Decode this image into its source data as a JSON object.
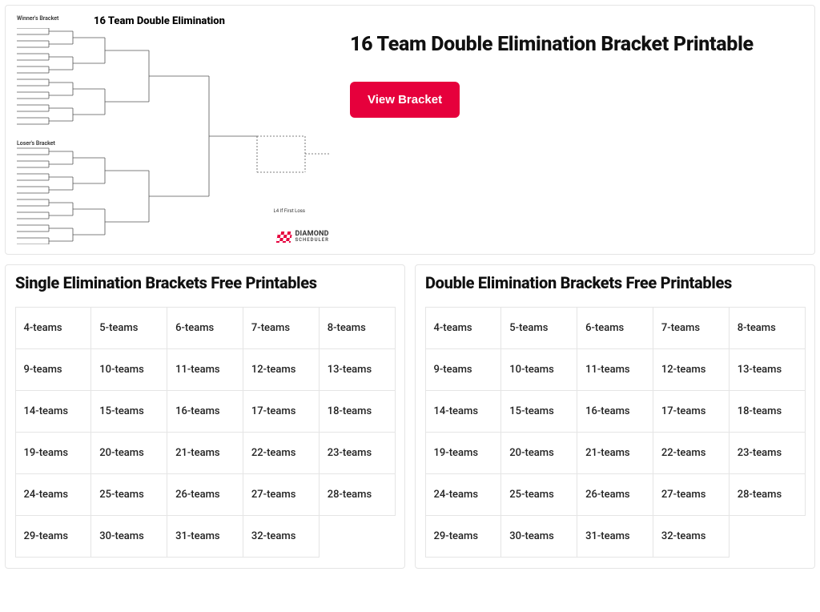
{
  "top": {
    "winners_label": "Winner's Bracket",
    "losers_label": "Loser's Bracket",
    "thumb_title": "16 Team Double Elimination",
    "note": "L4 If First Loss",
    "logo_line1": "DIAMOND",
    "logo_line2": "SCHEDULER",
    "heading": "16 Team Double Elimination Bracket Printable",
    "button": "View Bracket"
  },
  "single": {
    "heading": "Single Elimination Brackets Free Printables",
    "items": [
      "4-teams",
      "5-teams",
      "6-teams",
      "7-teams",
      "8-teams",
      "9-teams",
      "10-teams",
      "11-teams",
      "12-teams",
      "13-teams",
      "14-teams",
      "15-teams",
      "16-teams",
      "17-teams",
      "18-teams",
      "19-teams",
      "20-teams",
      "21-teams",
      "22-teams",
      "23-teams",
      "24-teams",
      "25-teams",
      "26-teams",
      "27-teams",
      "28-teams",
      "29-teams",
      "30-teams",
      "31-teams",
      "32-teams"
    ]
  },
  "double": {
    "heading": "Double Elimination Brackets Free Printables",
    "items": [
      "4-teams",
      "5-teams",
      "6-teams",
      "7-teams",
      "8-teams",
      "9-teams",
      "10-teams",
      "11-teams",
      "12-teams",
      "13-teams",
      "14-teams",
      "15-teams",
      "16-teams",
      "17-teams",
      "18-teams",
      "19-teams",
      "20-teams",
      "21-teams",
      "22-teams",
      "23-teams",
      "24-teams",
      "25-teams",
      "26-teams",
      "27-teams",
      "28-teams",
      "29-teams",
      "30-teams",
      "31-teams",
      "32-teams"
    ]
  }
}
